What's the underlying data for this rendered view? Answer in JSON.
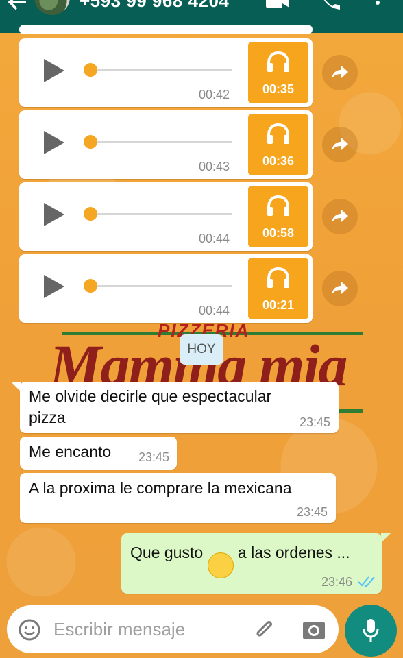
{
  "header": {
    "contact": "+593 99 968 4204"
  },
  "audio_messages": [
    {
      "time": "00:42",
      "duration": "00:35"
    },
    {
      "time": "00:43",
      "duration": "00:36"
    },
    {
      "time": "00:44",
      "duration": "00:58"
    },
    {
      "time": "00:44",
      "duration": "00:21"
    }
  ],
  "watermark": {
    "brand_small": "PIZZERIA",
    "brand_large": "Mamma mia"
  },
  "date_chip": "HOY",
  "messages": [
    {
      "direction": "in",
      "line1": "Me olvide decirle que espectacular",
      "line2": "pizza",
      "time": "23:45"
    },
    {
      "direction": "in",
      "text": "Me encanto",
      "time": "23:45"
    },
    {
      "direction": "in",
      "text": "A la proxima le comprare la mexicana",
      "time": "23:45"
    },
    {
      "direction": "out",
      "text_before": "Que gusto",
      "emoji": "😁",
      "text_after": "a las ordenes ...",
      "time": "23:46",
      "status": "read"
    }
  ],
  "composer": {
    "placeholder": "Escribir mensaje"
  },
  "colors": {
    "header": "#075e54",
    "accent_orange": "#f7a51c",
    "outgoing_bubble": "#dcf8c6",
    "read_ticks": "#4fc3f7",
    "mic_button": "#128c7e"
  }
}
